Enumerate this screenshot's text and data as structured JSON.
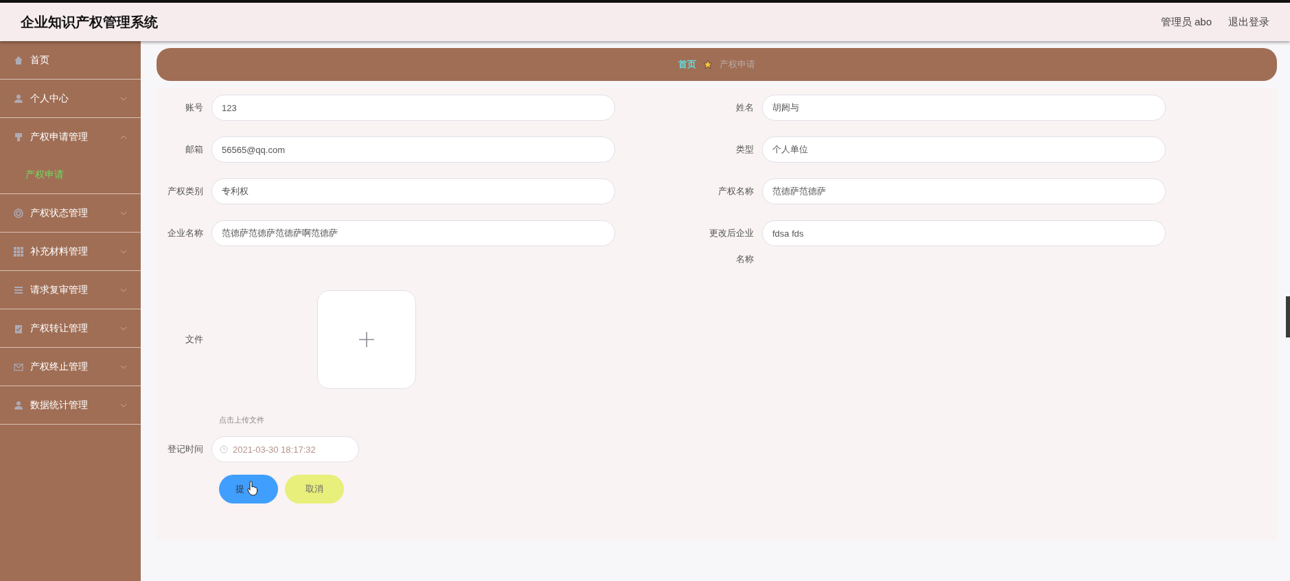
{
  "header": {
    "title": "企业知识产权管理系统",
    "user": "管理员 abo",
    "logout": "退出登录"
  },
  "sidebar": {
    "items": [
      {
        "label": "首页",
        "kind": "link"
      },
      {
        "label": "个人中心",
        "kind": "submenu",
        "expanded": false
      },
      {
        "label": "产权申请管理",
        "kind": "submenu",
        "expanded": true,
        "children": [
          {
            "label": "产权申请",
            "selected": true
          }
        ]
      },
      {
        "label": "产权状态管理",
        "kind": "submenu",
        "expanded": false
      },
      {
        "label": "补充材料管理",
        "kind": "submenu",
        "expanded": false
      },
      {
        "label": "请求复审管理",
        "kind": "submenu",
        "expanded": false
      },
      {
        "label": "产权转让管理",
        "kind": "submenu",
        "expanded": false
      },
      {
        "label": "产权终止管理",
        "kind": "submenu",
        "expanded": false
      },
      {
        "label": "数据统计管理",
        "kind": "submenu",
        "expanded": false
      }
    ]
  },
  "breadcrumb": {
    "home": "首页",
    "current": "产权申请"
  },
  "form": {
    "fields": [
      {
        "label": "账号",
        "value": "123"
      },
      {
        "label": "姓名",
        "value": "胡阏与"
      },
      {
        "label": "邮箱",
        "value": "56565@qq.com"
      },
      {
        "label": "类型",
        "value": "个人单位"
      },
      {
        "label": "产权类别",
        "value": "专利权"
      },
      {
        "label": "产权名称",
        "value": "范德萨范德萨"
      },
      {
        "label": "企业名称",
        "value": "范德萨范德萨范德萨啊范德萨"
      },
      {
        "label": "更改后企业名称",
        "value": "fdsa fds"
      }
    ],
    "upload": {
      "label": "文件",
      "hint": "点击上传文件"
    },
    "date": {
      "label": "登记时间",
      "value": "2021-03-30 18:17:32"
    },
    "buttons": [
      {
        "label": "提",
        "kind": "primary"
      },
      {
        "label": "取消",
        "kind": "cancel"
      }
    ]
  }
}
